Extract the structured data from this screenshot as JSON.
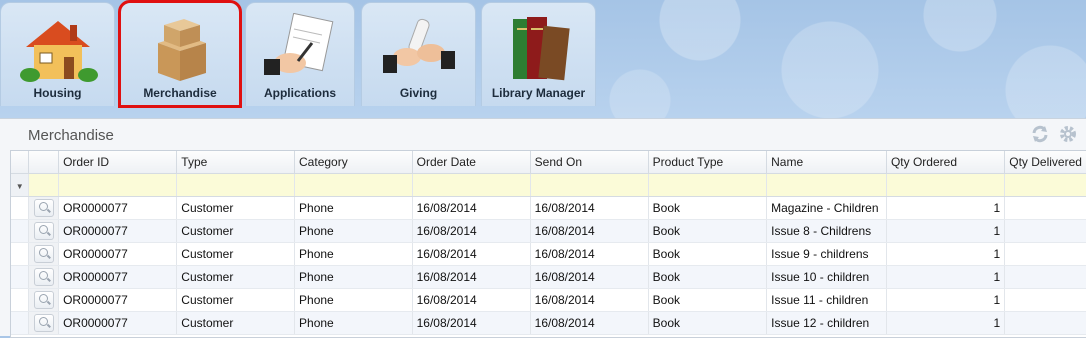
{
  "tabs": [
    {
      "label": "Housing",
      "icon": "house-icon"
    },
    {
      "label": "Merchandise",
      "icon": "boxes-icon",
      "active": true
    },
    {
      "label": "Applications",
      "icon": "signing-hand-icon"
    },
    {
      "label": "Giving",
      "icon": "handshake-icon"
    },
    {
      "label": "Library Manager",
      "icon": "books-icon"
    }
  ],
  "panel": {
    "title": "Merchandise",
    "tools": [
      "refresh-icon",
      "settings-icon"
    ]
  },
  "grid": {
    "columns": [
      "Order ID",
      "Type",
      "Category",
      "Order Date",
      "Send On",
      "Product Type",
      "Name",
      "Qty Ordered",
      "Qty Delivered"
    ],
    "rows": [
      [
        "OR0000077",
        "Customer",
        "Phone",
        "16/08/2014",
        "16/08/2014",
        "Book",
        "Magazine - Children",
        "1",
        ""
      ],
      [
        "OR0000077",
        "Customer",
        "Phone",
        "16/08/2014",
        "16/08/2014",
        "Book",
        "Issue 8 - Childrens",
        "1",
        ""
      ],
      [
        "OR0000077",
        "Customer",
        "Phone",
        "16/08/2014",
        "16/08/2014",
        "Book",
        "Issue 9 - childrens",
        "1",
        ""
      ],
      [
        "OR0000077",
        "Customer",
        "Phone",
        "16/08/2014",
        "16/08/2014",
        "Book",
        "Issue 10 - children",
        "1",
        ""
      ],
      [
        "OR0000077",
        "Customer",
        "Phone",
        "16/08/2014",
        "16/08/2014",
        "Book",
        "Issue 11 - children",
        "1",
        ""
      ],
      [
        "OR0000077",
        "Customer",
        "Phone",
        "16/08/2014",
        "16/08/2014",
        "Book",
        "Issue 12 - children",
        "1",
        ""
      ]
    ]
  }
}
